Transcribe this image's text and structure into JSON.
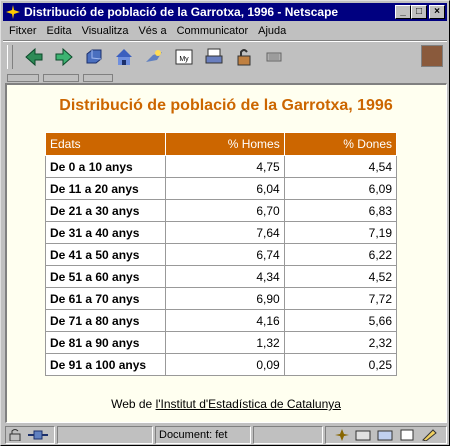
{
  "window": {
    "title": "Distribució de població de la Garrotxa, 1996 - Netscape",
    "minimize": "_",
    "maximize": "□",
    "close": "×"
  },
  "menu": [
    "Fitxer",
    "Edita",
    "Visualitza",
    "Vés a",
    "Communicator",
    "Ajuda"
  ],
  "toolbar": {
    "icons": [
      "back-icon",
      "forward-icon",
      "reload-icon",
      "home-icon",
      "search-icon",
      "my-netscape-icon",
      "print-icon",
      "security-icon",
      "stop-icon"
    ],
    "my_label": "My"
  },
  "page": {
    "title": "Distribució de població de la Garrotxa, 1996",
    "table": {
      "headers": [
        "Edats",
        "% Homes",
        "% Dones"
      ],
      "rows": [
        [
          "De 0 a 10 anys",
          "4,75",
          "4,54"
        ],
        [
          "De 11 a 20 anys",
          "6,04",
          "6,09"
        ],
        [
          "De 21 a 30 anys",
          "6,70",
          "6,83"
        ],
        [
          "De 31 a 40 anys",
          "7,64",
          "7,19"
        ],
        [
          "De 41 a 50 anys",
          "6,74",
          "6,22"
        ],
        [
          "De 51 a 60 anys",
          "4,34",
          "4,52"
        ],
        [
          "De 61 a 70 anys",
          "6,90",
          "7,72"
        ],
        [
          "De 71 a 80 anys",
          "4,16",
          "5,66"
        ],
        [
          "De 81 a 90 anys",
          "1,32",
          "2,32"
        ],
        [
          "De 91 a 100 anys",
          "0,09",
          "0,25"
        ]
      ]
    },
    "footer_prefix": "Web de ",
    "footer_link": "l'Institut d'Estadística de Catalunya"
  },
  "status": {
    "text": "Document: fet"
  }
}
